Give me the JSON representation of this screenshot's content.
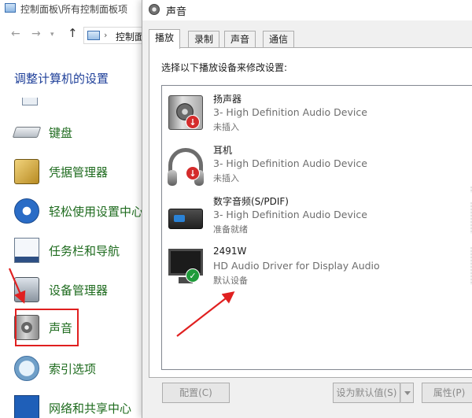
{
  "control_panel": {
    "title": "控制面板\\所有控制面板项",
    "address": "控制面",
    "heading": "调整计算机的设置",
    "items": [
      {
        "label": "键盘",
        "icon": "keyboard-icon"
      },
      {
        "label": "凭据管理器",
        "icon": "credential-manager-icon"
      },
      {
        "label": "轻松使用设置中心",
        "icon": "ease-of-access-icon"
      },
      {
        "label": "任务栏和导航",
        "icon": "taskbar-icon"
      },
      {
        "label": "设备管理器",
        "icon": "device-manager-icon"
      },
      {
        "label": "声音",
        "icon": "sound-icon"
      },
      {
        "label": "索引选项",
        "icon": "indexing-icon"
      },
      {
        "label": "网络和共享中心",
        "icon": "network-icon"
      }
    ]
  },
  "dialog": {
    "title": "声音",
    "tabs": [
      "播放",
      "录制",
      "声音",
      "通信"
    ],
    "instruction": "选择以下播放设备来修改设置:",
    "devices": [
      {
        "name": "扬声器",
        "desc": "3- High Definition Audio Device",
        "status": "未插入",
        "icon": "speaker-icon",
        "badge": "down-arrow"
      },
      {
        "name": "耳机",
        "desc": "3- High Definition Audio Device",
        "status": "未插入",
        "icon": "headphones-icon",
        "badge": "down-arrow"
      },
      {
        "name": "数字音频(S/PDIF)",
        "desc": "3- High Definition Audio Device",
        "status": "准备就绪",
        "icon": "spdif-icon",
        "badge": ""
      },
      {
        "name": "2491W",
        "desc": "HD Audio Driver for Display Audio",
        "status": "默认设备",
        "icon": "monitor-icon",
        "badge": "check"
      }
    ],
    "buttons": {
      "configure": "配置(C)",
      "set_default": "设为默认值(S)",
      "properties": "属性(P)"
    }
  },
  "colors": {
    "annotation": "#e02020",
    "link_green": "#1e6b1e",
    "heading_blue": "#1e3f99"
  }
}
